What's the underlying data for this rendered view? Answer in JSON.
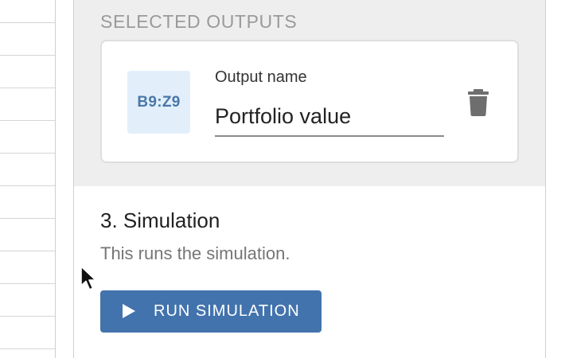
{
  "outputs": {
    "heading": "SELECTED OUTPUTS",
    "items": [
      {
        "range": "B9:Z9",
        "name_label": "Output name",
        "name_value": "Portfolio value"
      }
    ]
  },
  "simulation": {
    "title": "3. Simulation",
    "description": "This runs the simulation.",
    "run_label": "RUN SIMULATION"
  },
  "icons": {
    "delete": "trash-icon",
    "run": "play-icon",
    "pointer": "mouse-cursor-icon"
  },
  "colors": {
    "primary": "#4273ad",
    "chip_bg": "#e2effb",
    "chip_text": "#4a77a8",
    "section_bg": "#eeeeee"
  }
}
